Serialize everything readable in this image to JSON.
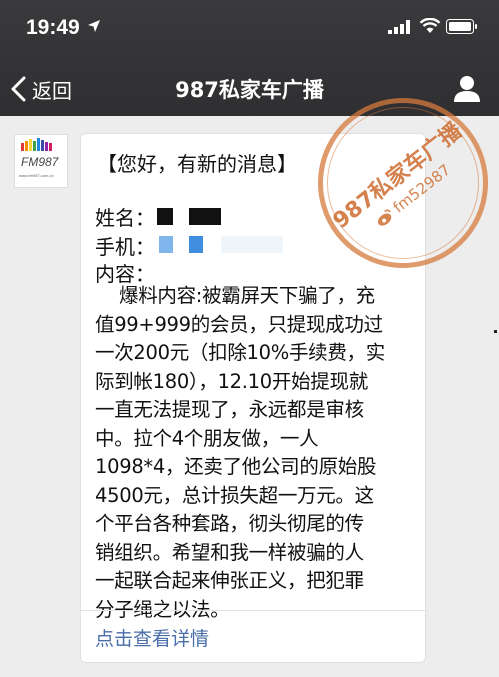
{
  "status_bar": {
    "time": "19:49"
  },
  "nav": {
    "back_label": "返回",
    "title": "987私家车广播"
  },
  "message": {
    "header": "【您好，有新的消息】",
    "name_label": "姓名：",
    "phone_label": "手机：",
    "content_label": "内容：",
    "body_lines": [
      "爆料内容:被霸屏天下骗了，充",
      "值99+999的会员，只提现成功过",
      "一次200元（扣除10%手续费，实",
      "际到帐180），12.10开始提现就",
      "一直无法提现了，永远都是审核",
      "中。拉个4个朋友做，一人",
      "1098*4，还卖了他公司的原始股",
      "4500元，总计损失超一万元。这",
      "个平台各种套路，彻头彻尾的传",
      "销组织。希望和我一样被骗的人",
      "一起联合起来伸张正义，把犯罪",
      "分子绳之以法。"
    ],
    "link_label": "点击查看详情"
  },
  "watermark": {
    "line1": "987私家车广播",
    "line2": "fm52987"
  },
  "avatar_logo": {
    "text": "FM987",
    "small": "www.fm987.com.cn"
  },
  "colors": {
    "nav_bg": "#2f2f31",
    "page_bg": "#ededed",
    "link": "#4a6ea9",
    "stamp": "#ce7034"
  }
}
